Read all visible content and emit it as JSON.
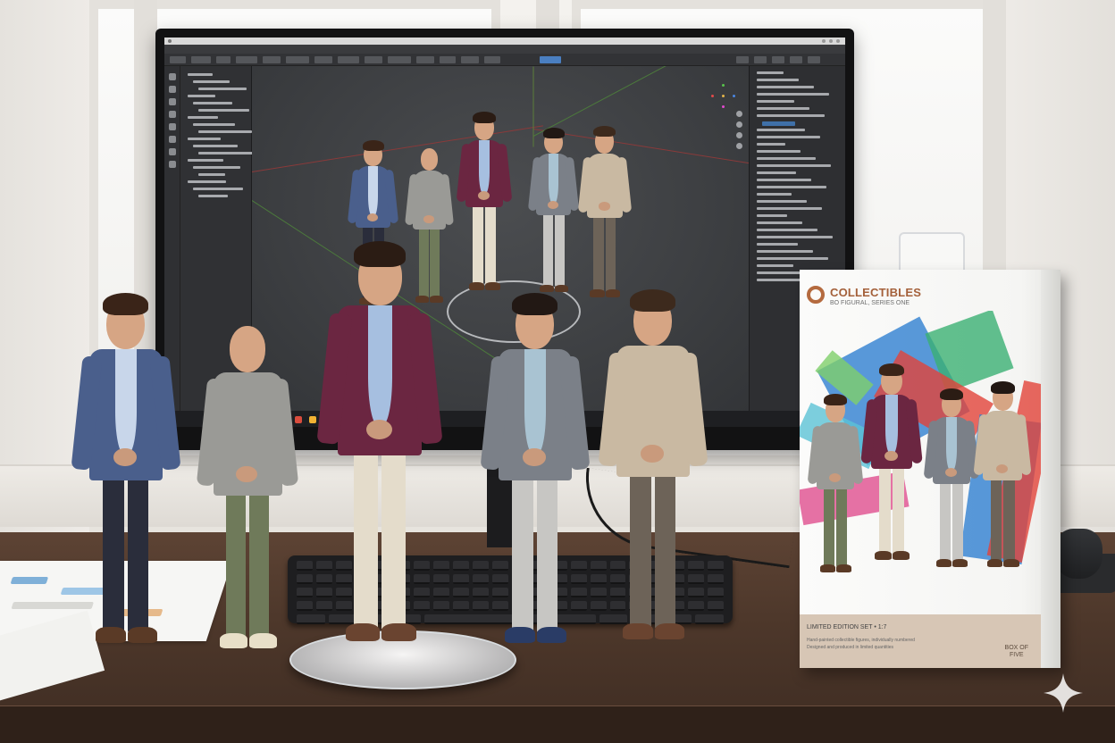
{
  "scene": {
    "software_window": {
      "toolbar_active_button": "active",
      "outliner_rows": 18,
      "property_rows": 30
    }
  },
  "figures": {
    "on_screen": [
      {
        "label": "figure-1",
        "jacket": "#4a5f8c",
        "pants": "#2a2d3b",
        "shirt": "#c8d6ea"
      },
      {
        "label": "figure-2",
        "jacket": "#9a9a96",
        "pants": "#6f7a5a",
        "shirt": "#9a9a96"
      },
      {
        "label": "figure-3",
        "jacket": "#6b2641",
        "pants": "#e4dccb",
        "shirt": "#a6bfe0"
      },
      {
        "label": "figure-4",
        "jacket": "#7b8088",
        "pants": "#c7c6c3",
        "shirt": "#a9c3d2"
      },
      {
        "label": "figure-5",
        "jacket": "#c9b9a2",
        "pants": "#6d6358",
        "shirt": "#c9b9a2"
      }
    ]
  },
  "package": {
    "brand": "COLLECTIBLES",
    "subtitle": "BO FIGURAL, SERIES ONE",
    "footer_line1": "LIMITED EDITION SET • 1:7",
    "footer_line2": "Hand-painted collectible figures, individually numbered",
    "footer_line3": "Designed and produced in limited quantities",
    "corner_mark": "BOX OF\nFIVE",
    "accent_color": "#b46a3f",
    "art_colors": [
      "#2f7fd1",
      "#e2443a",
      "#3bb073",
      "#5cc3d6",
      "#e04f8f",
      "#7fcf6a"
    ]
  },
  "watermark": {
    "icon": "sparkle-icon",
    "color": "#ffffff"
  }
}
